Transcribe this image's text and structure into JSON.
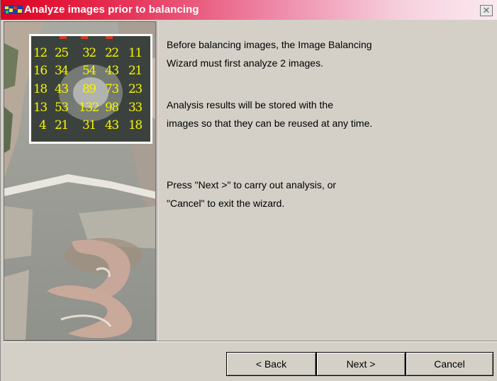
{
  "window": {
    "title": "Analyze images prior to balancing",
    "close_label": "✕"
  },
  "illustration": {
    "grid": [
      [
        "12",
        "25",
        "32",
        "22",
        "11"
      ],
      [
        "16",
        "34",
        "54",
        "43",
        "21"
      ],
      [
        "18",
        "43",
        "89",
        "73",
        "23"
      ],
      [
        "13",
        "53",
        "132",
        "98",
        "33"
      ],
      [
        "4",
        "21",
        "31",
        "43",
        "18"
      ]
    ]
  },
  "message": {
    "line1": "Before balancing images, the Image Balancing",
    "line2": "Wizard must first analyze 2 images.",
    "line3": "Analysis results will be stored with the",
    "line4": "images so that they can be reused at any time.",
    "line5": "Press \"Next >\" to carry out analysis, or",
    "line6": "\"Cancel\" to exit the wizard."
  },
  "buttons": {
    "back": "< Back",
    "next": "Next >",
    "cancel": "Cancel"
  }
}
